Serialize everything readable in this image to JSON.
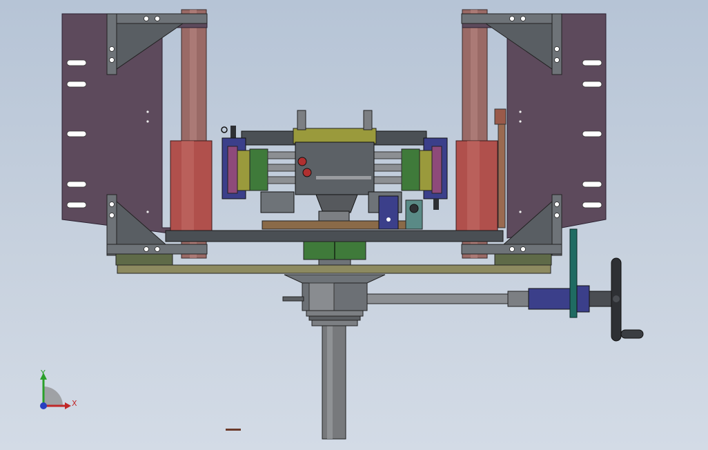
{
  "colors": {
    "background_top": "#b6c4d6",
    "background_bottom": "#d3dbe6",
    "side_plate": "#5d4a5c",
    "bracket": "#6e7378",
    "rod": "#9a6a66",
    "cylinder": "#b0504c",
    "crossbar": "#4a4f54",
    "base_plate": "#6b6f4e",
    "green_part": "#3f7a3a",
    "yellow_part": "#9a9a3c",
    "blue_part": "#3b3f8a",
    "column": "#77797c",
    "teal_bar": "#1f6b62",
    "axis_y": "#2aa02a",
    "axis_x": "#c02828",
    "axis_z": "#2840c0"
  },
  "triad": {
    "y_label": "Y",
    "x_label": "X"
  },
  "icons": {
    "triad": "coordinate-triad-icon",
    "handwheel": "handwheel-icon"
  }
}
